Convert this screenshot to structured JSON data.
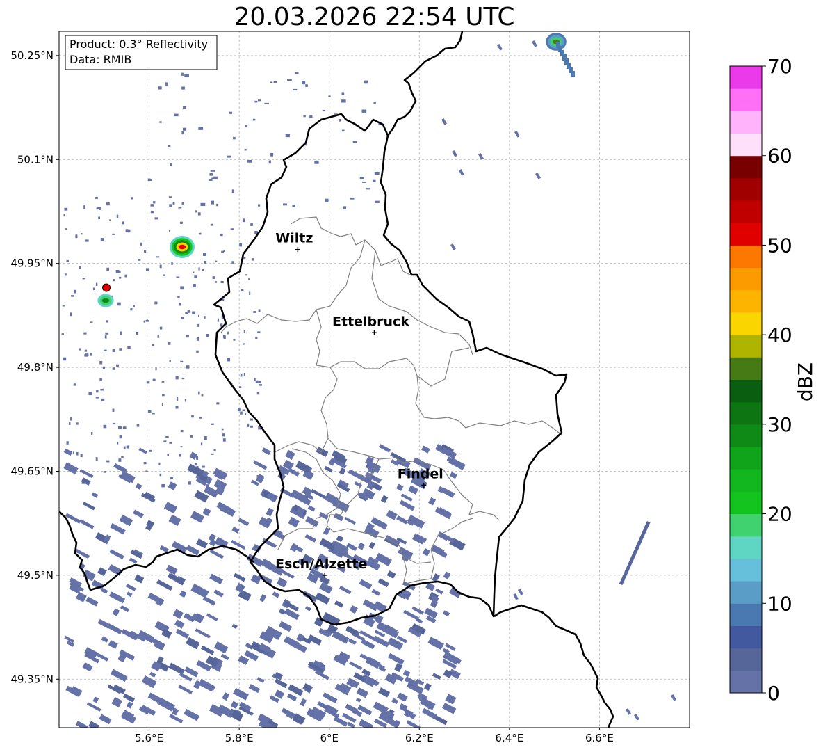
{
  "title": "20.03.2026 22:54 UTC",
  "info_box": {
    "product": "Product: 0.3° Reflectivity",
    "data_source": "Data: RMIB"
  },
  "map": {
    "type": "radar-reflectivity-map",
    "lon_range": [
      5.4,
      6.8
    ],
    "lat_range": [
      49.3,
      50.3
    ],
    "x_ticks": [
      {
        "value": 5.6,
        "label": "5.6°E"
      },
      {
        "value": 5.8,
        "label": "5.8°E"
      },
      {
        "value": 6.0,
        "label": "6°E"
      },
      {
        "value": 6.2,
        "label": "6.2°E"
      },
      {
        "value": 6.4,
        "label": "6.4°E"
      },
      {
        "value": 6.6,
        "label": "6.6°E"
      }
    ],
    "y_ticks": [
      {
        "value": 50.25,
        "label": "50.25°N"
      },
      {
        "value": 50.1,
        "label": "50.1°N"
      },
      {
        "value": 49.95,
        "label": "49.95°N"
      },
      {
        "value": 49.8,
        "label": "49.8°N"
      },
      {
        "value": 49.65,
        "label": "49.65°N"
      },
      {
        "value": 49.5,
        "label": "49.5°N"
      },
      {
        "value": 49.35,
        "label": "49.35°N"
      }
    ],
    "gridlines": true,
    "cities": [
      {
        "name": "Wiltz",
        "lon": 5.93,
        "lat": 49.97
      },
      {
        "name": "Ettelbruck",
        "lon": 6.1,
        "lat": 49.85
      },
      {
        "name": "Findel",
        "lon": 6.21,
        "lat": 49.63
      },
      {
        "name": "Esch/Alzette",
        "lon": 5.99,
        "lat": 49.5
      }
    ],
    "radar_site": {
      "lon": 5.505,
      "lat": 49.915,
      "color": "#e00000"
    }
  },
  "colorbar": {
    "label": "dBZ",
    "min": 0,
    "max": 70,
    "ticks": [
      "0",
      "10",
      "20",
      "30",
      "40",
      "50",
      "60",
      "70"
    ],
    "colors": [
      "#6472a8",
      "#566699",
      "#43599f",
      "#4a78b0",
      "#5a9ec8",
      "#66c0dc",
      "#5fd6c4",
      "#40d26e",
      "#14c41e",
      "#12b61e",
      "#10a41a",
      "#0f8a16",
      "#0d7512",
      "#0a5e10",
      "#457a14",
      "#afb400",
      "#fbd500",
      "#fcb400",
      "#fc9b00",
      "#fc7800",
      "#e00000",
      "#c00000",
      "#a00000",
      "#780000",
      "#ffe0fb",
      "#ffb3fb",
      "#ff70f6",
      "#ea3aea"
    ]
  }
}
